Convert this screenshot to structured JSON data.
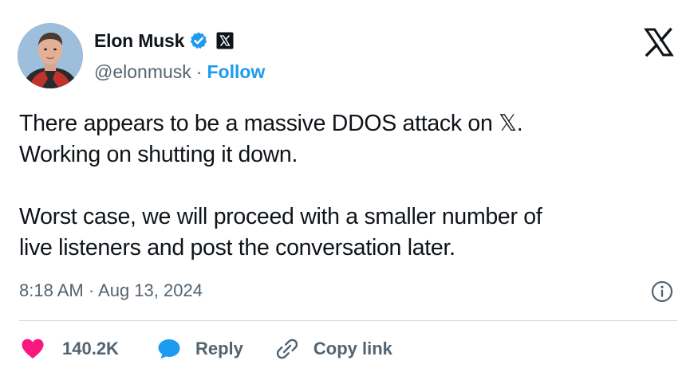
{
  "author": {
    "display_name": "Elon Musk",
    "handle": "@elonmusk",
    "separator": "·",
    "follow_label": "Follow",
    "verified_icon": "verified-badge-icon",
    "affiliation_icon": "x-affiliation-icon"
  },
  "tweet": {
    "lines": [
      "There appears to be a massive DDOS attack on 𝕏.",
      "Working on shutting it down.",
      "Worst case, we will proceed with a smaller number of",
      "live listeners and post the conversation later."
    ],
    "timestamp": "8:18 AM · Aug 13, 2024"
  },
  "actions": {
    "like_count": "140.2K",
    "reply_label": "Reply",
    "copy_link_label": "Copy link"
  },
  "colors": {
    "accent": "#1d9bf0",
    "like": "#f91880",
    "text": "#0f1419",
    "secondary": "#536471"
  }
}
